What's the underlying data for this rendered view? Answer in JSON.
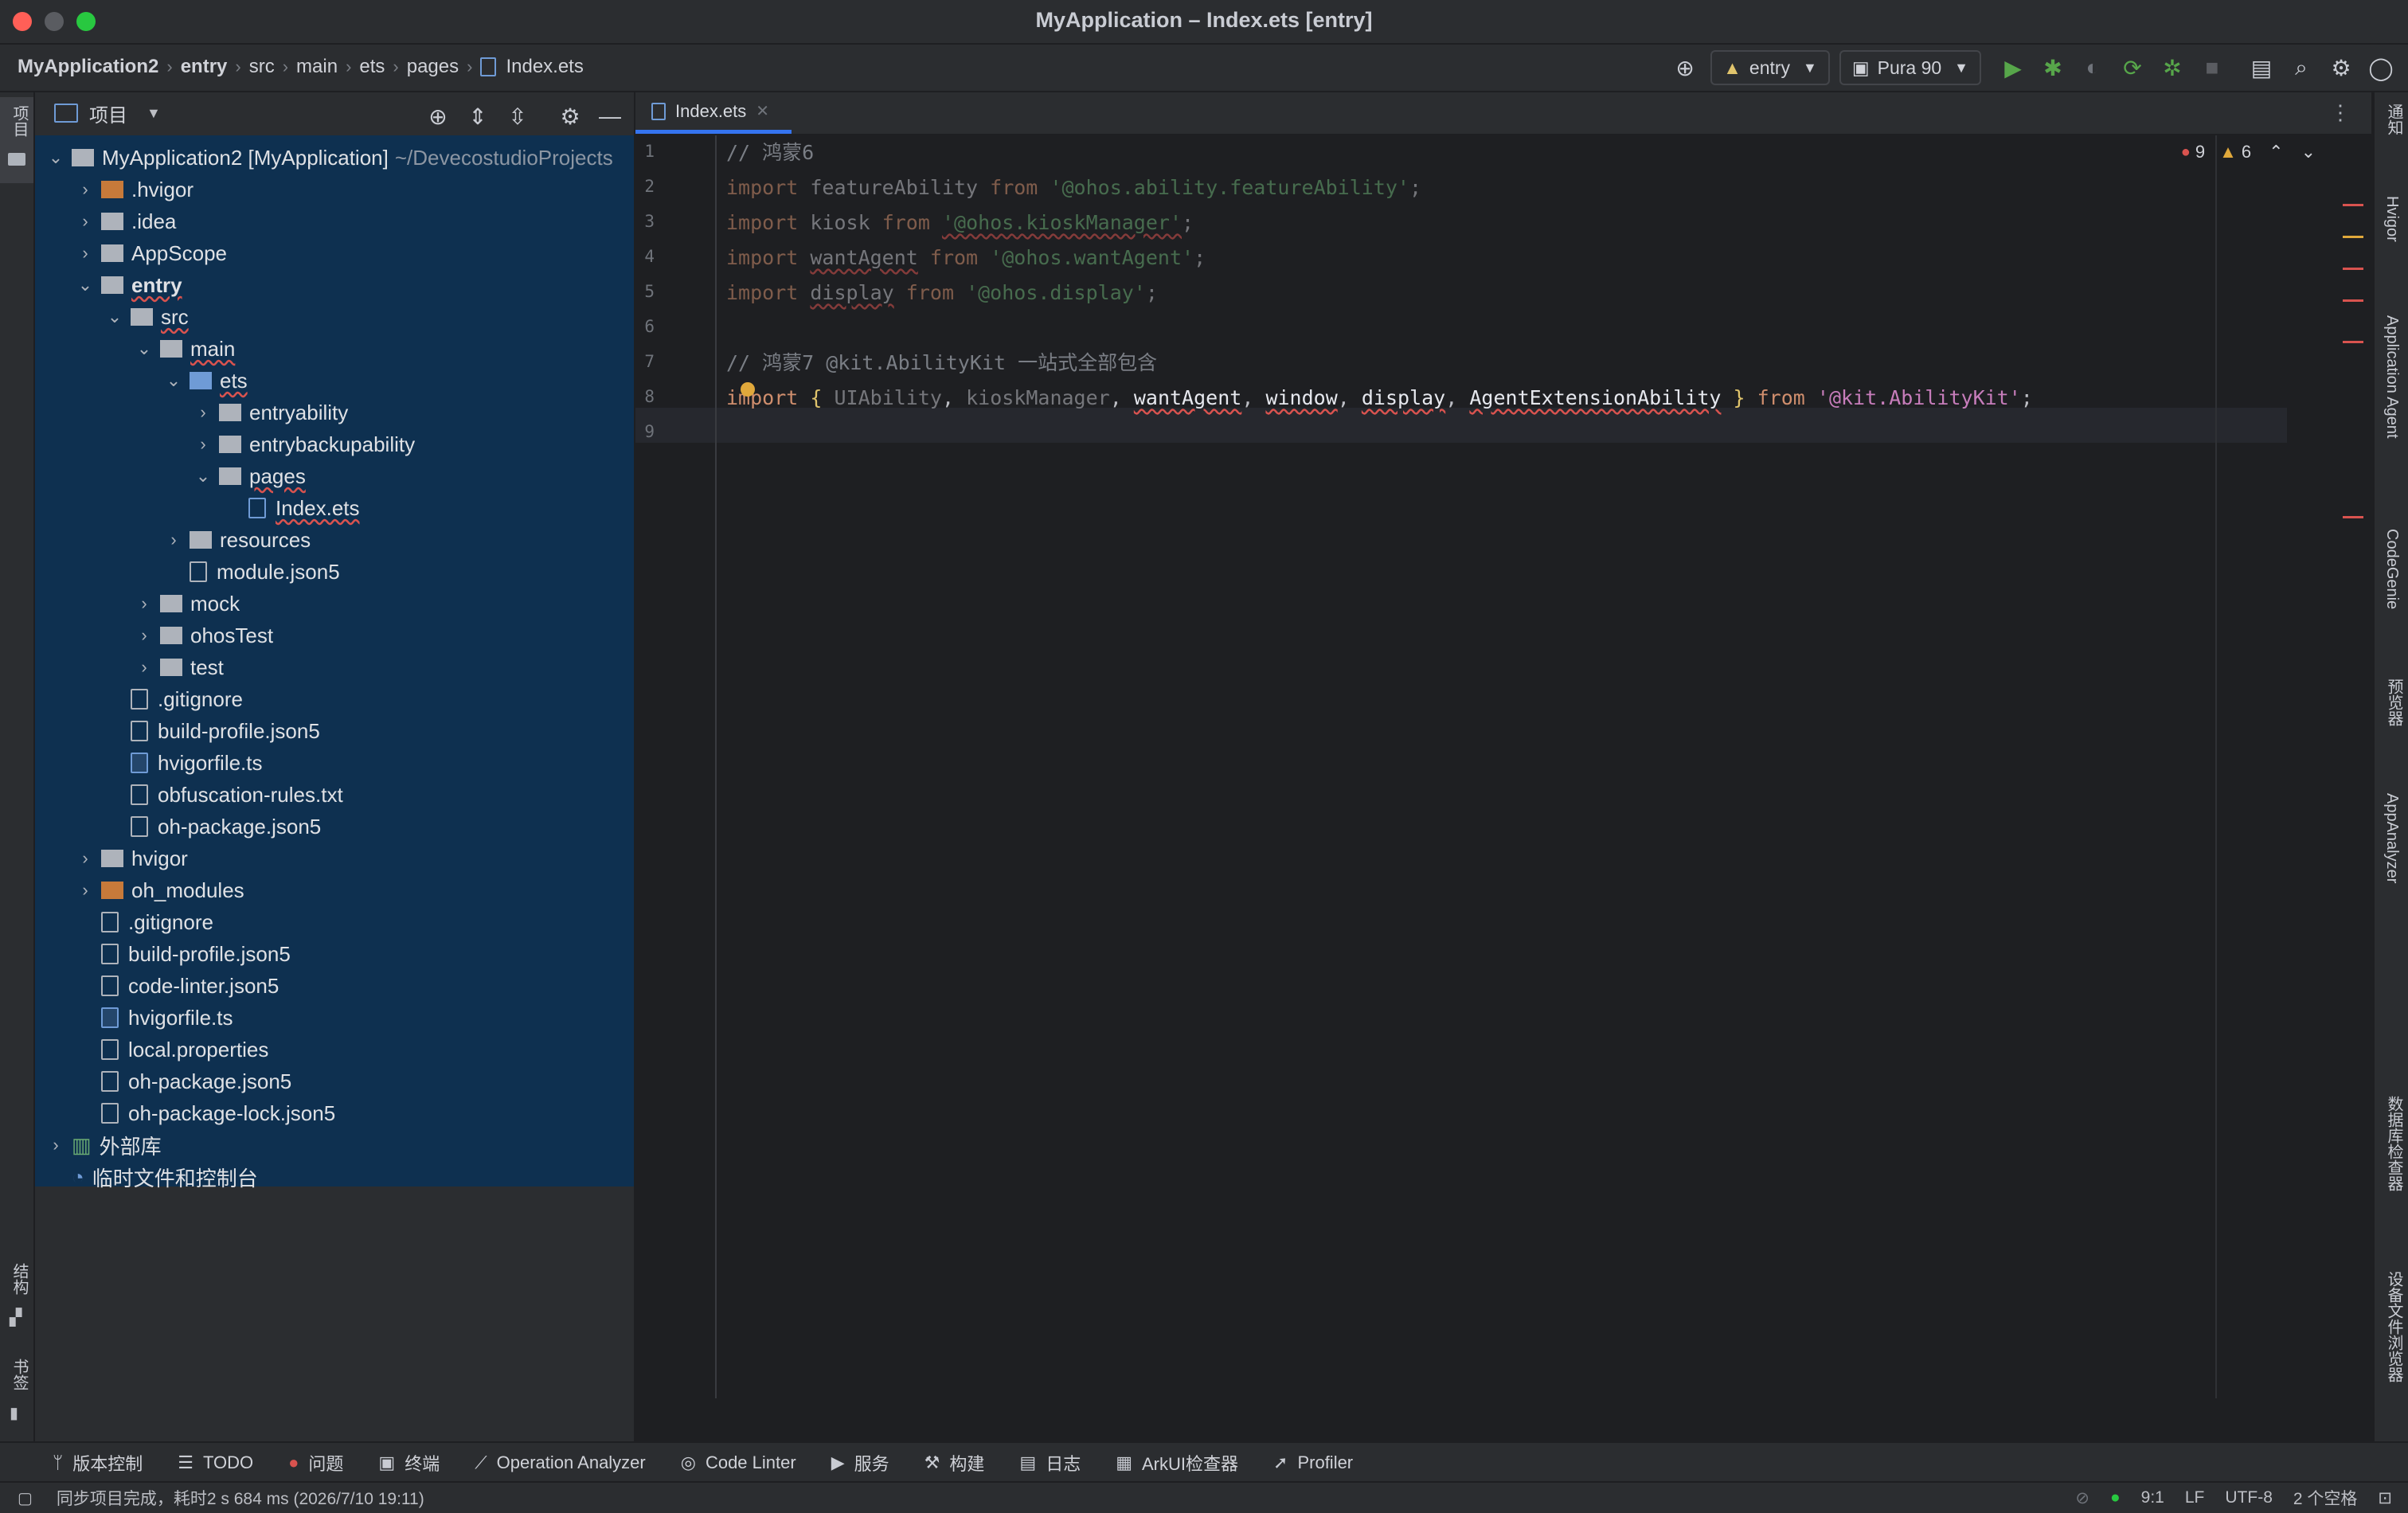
{
  "window": {
    "title": "MyApplication – Index.ets [entry]"
  },
  "breadcrumb": [
    "MyApplication2",
    "entry",
    "src",
    "main",
    "ets",
    "pages",
    "Index.ets"
  ],
  "toolbar": {
    "run_config": "entry",
    "device": "Pura 90"
  },
  "left_strip": {
    "project_label": "项目",
    "structure_label": "结构",
    "bookmarks_label": "书签"
  },
  "project_panel": {
    "header_label": "项目"
  },
  "tree": [
    {
      "label": "MyApplication2 [MyApplication]",
      "suffix": "~/DevecostudioProjects",
      "depth": 0,
      "arrow": "open",
      "icon": "module"
    },
    {
      "label": ".hvigor",
      "depth": 1,
      "arrow": "closed",
      "icon": "folder-orange"
    },
    {
      "label": ".idea",
      "depth": 1,
      "arrow": "closed",
      "icon": "folder"
    },
    {
      "label": "AppScope",
      "depth": 1,
      "arrow": "closed",
      "icon": "folder"
    },
    {
      "label": "entry",
      "depth": 1,
      "arrow": "open",
      "icon": "module"
    },
    {
      "label": "src",
      "depth": 2,
      "arrow": "open",
      "icon": "folder"
    },
    {
      "label": "main",
      "depth": 3,
      "arrow": "open",
      "icon": "folder"
    },
    {
      "label": "ets",
      "depth": 4,
      "arrow": "open",
      "icon": "folder-blue"
    },
    {
      "label": "entryability",
      "depth": 5,
      "arrow": "closed",
      "icon": "folder"
    },
    {
      "label": "entrybackupability",
      "depth": 5,
      "arrow": "closed",
      "icon": "folder"
    },
    {
      "label": "pages",
      "depth": 5,
      "arrow": "open",
      "icon": "folder"
    },
    {
      "label": "Index.ets",
      "depth": 6,
      "arrow": "none",
      "icon": "ets"
    },
    {
      "label": "resources",
      "depth": 4,
      "arrow": "closed",
      "icon": "folder"
    },
    {
      "label": "module.json5",
      "depth": 4,
      "arrow": "none",
      "icon": "json"
    },
    {
      "label": "mock",
      "depth": 3,
      "arrow": "closed",
      "icon": "folder"
    },
    {
      "label": "ohosTest",
      "depth": 3,
      "arrow": "closed",
      "icon": "folder"
    },
    {
      "label": "test",
      "depth": 3,
      "arrow": "closed",
      "icon": "folder"
    },
    {
      "label": ".gitignore",
      "depth": 2,
      "arrow": "none",
      "icon": "file"
    },
    {
      "label": "build-profile.json5",
      "depth": 2,
      "arrow": "none",
      "icon": "json"
    },
    {
      "label": "hvigorfile.ts",
      "depth": 2,
      "arrow": "none",
      "icon": "ts"
    },
    {
      "label": "obfuscation-rules.txt",
      "depth": 2,
      "arrow": "none",
      "icon": "file"
    },
    {
      "label": "oh-package.json5",
      "depth": 2,
      "arrow": "none",
      "icon": "json"
    },
    {
      "label": "hvigor",
      "depth": 1,
      "arrow": "closed",
      "icon": "folder"
    },
    {
      "label": "oh_modules",
      "depth": 1,
      "arrow": "closed",
      "icon": "folder-orange"
    },
    {
      "label": ".gitignore",
      "depth": 1,
      "arrow": "none",
      "icon": "file"
    },
    {
      "label": "build-profile.json5",
      "depth": 1,
      "arrow": "none",
      "icon": "json"
    },
    {
      "label": "code-linter.json5",
      "depth": 1,
      "arrow": "none",
      "icon": "json"
    },
    {
      "label": "hvigorfile.ts",
      "depth": 1,
      "arrow": "none",
      "icon": "ts"
    },
    {
      "label": "local.properties",
      "depth": 1,
      "arrow": "none",
      "icon": "properties"
    },
    {
      "label": "oh-package.json5",
      "depth": 1,
      "arrow": "none",
      "icon": "json"
    },
    {
      "label": "oh-package-lock.json5",
      "depth": 1,
      "arrow": "none",
      "icon": "json"
    },
    {
      "label": "外部库",
      "depth": 0,
      "arrow": "closed",
      "icon": "library"
    },
    {
      "label": "临时文件和控制台",
      "depth": 0,
      "arrow": "none",
      "icon": "scratch"
    }
  ],
  "editor": {
    "tab_label": "Index.ets",
    "errors": "9",
    "warnings": "6",
    "line_numbers": [
      "1",
      "2",
      "3",
      "4",
      "5",
      "6",
      "7",
      "8",
      "9"
    ]
  },
  "right_strip": [
    "通知",
    "Hvigor",
    "Application Agent",
    "CodeGenie",
    "预览器",
    "AppAnalyzer",
    "数据库检查器",
    "设备文件浏览器"
  ],
  "bottom_tools": [
    "版本控制",
    "TODO",
    "问题",
    "终端",
    "Operation Analyzer",
    "Code Linter",
    "服务",
    "构建",
    "日志",
    "ArkUI检查器",
    "Profiler"
  ],
  "status": {
    "message": "同步项目完成，耗时2 s 684 ms (2026/7/10 19:11)",
    "position": "9:1",
    "line_ending": "LF",
    "encoding": "UTF-8",
    "indent": "2 个空格"
  },
  "colors": {
    "tree_bg": "#0e3050",
    "accent": "#3574f0",
    "error": "#d9534f",
    "warning": "#e0a83b"
  }
}
